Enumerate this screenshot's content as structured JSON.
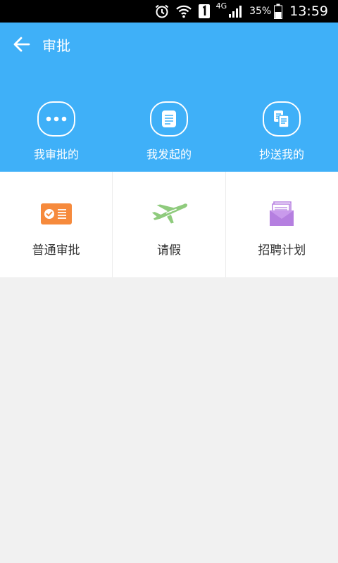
{
  "status": {
    "network": "4G",
    "battery": "35%",
    "time": "13:59"
  },
  "header": {
    "title": "审批"
  },
  "quick": [
    {
      "label": "我审批的",
      "icon": "more-dots-icon"
    },
    {
      "label": "我发起的",
      "icon": "document-icon"
    },
    {
      "label": "抄送我的",
      "icon": "copy-documents-icon"
    }
  ],
  "grid": [
    {
      "label": "普通审批",
      "icon": "approval-card-icon",
      "color": "#f68a3c"
    },
    {
      "label": "请假",
      "icon": "airplane-icon",
      "color": "#8fcb7d"
    },
    {
      "label": "招聘计划",
      "icon": "envelope-icon",
      "color": "#b57fe0"
    }
  ],
  "colors": {
    "primary": "#3fb0f8",
    "background": "#f1f1f1"
  }
}
